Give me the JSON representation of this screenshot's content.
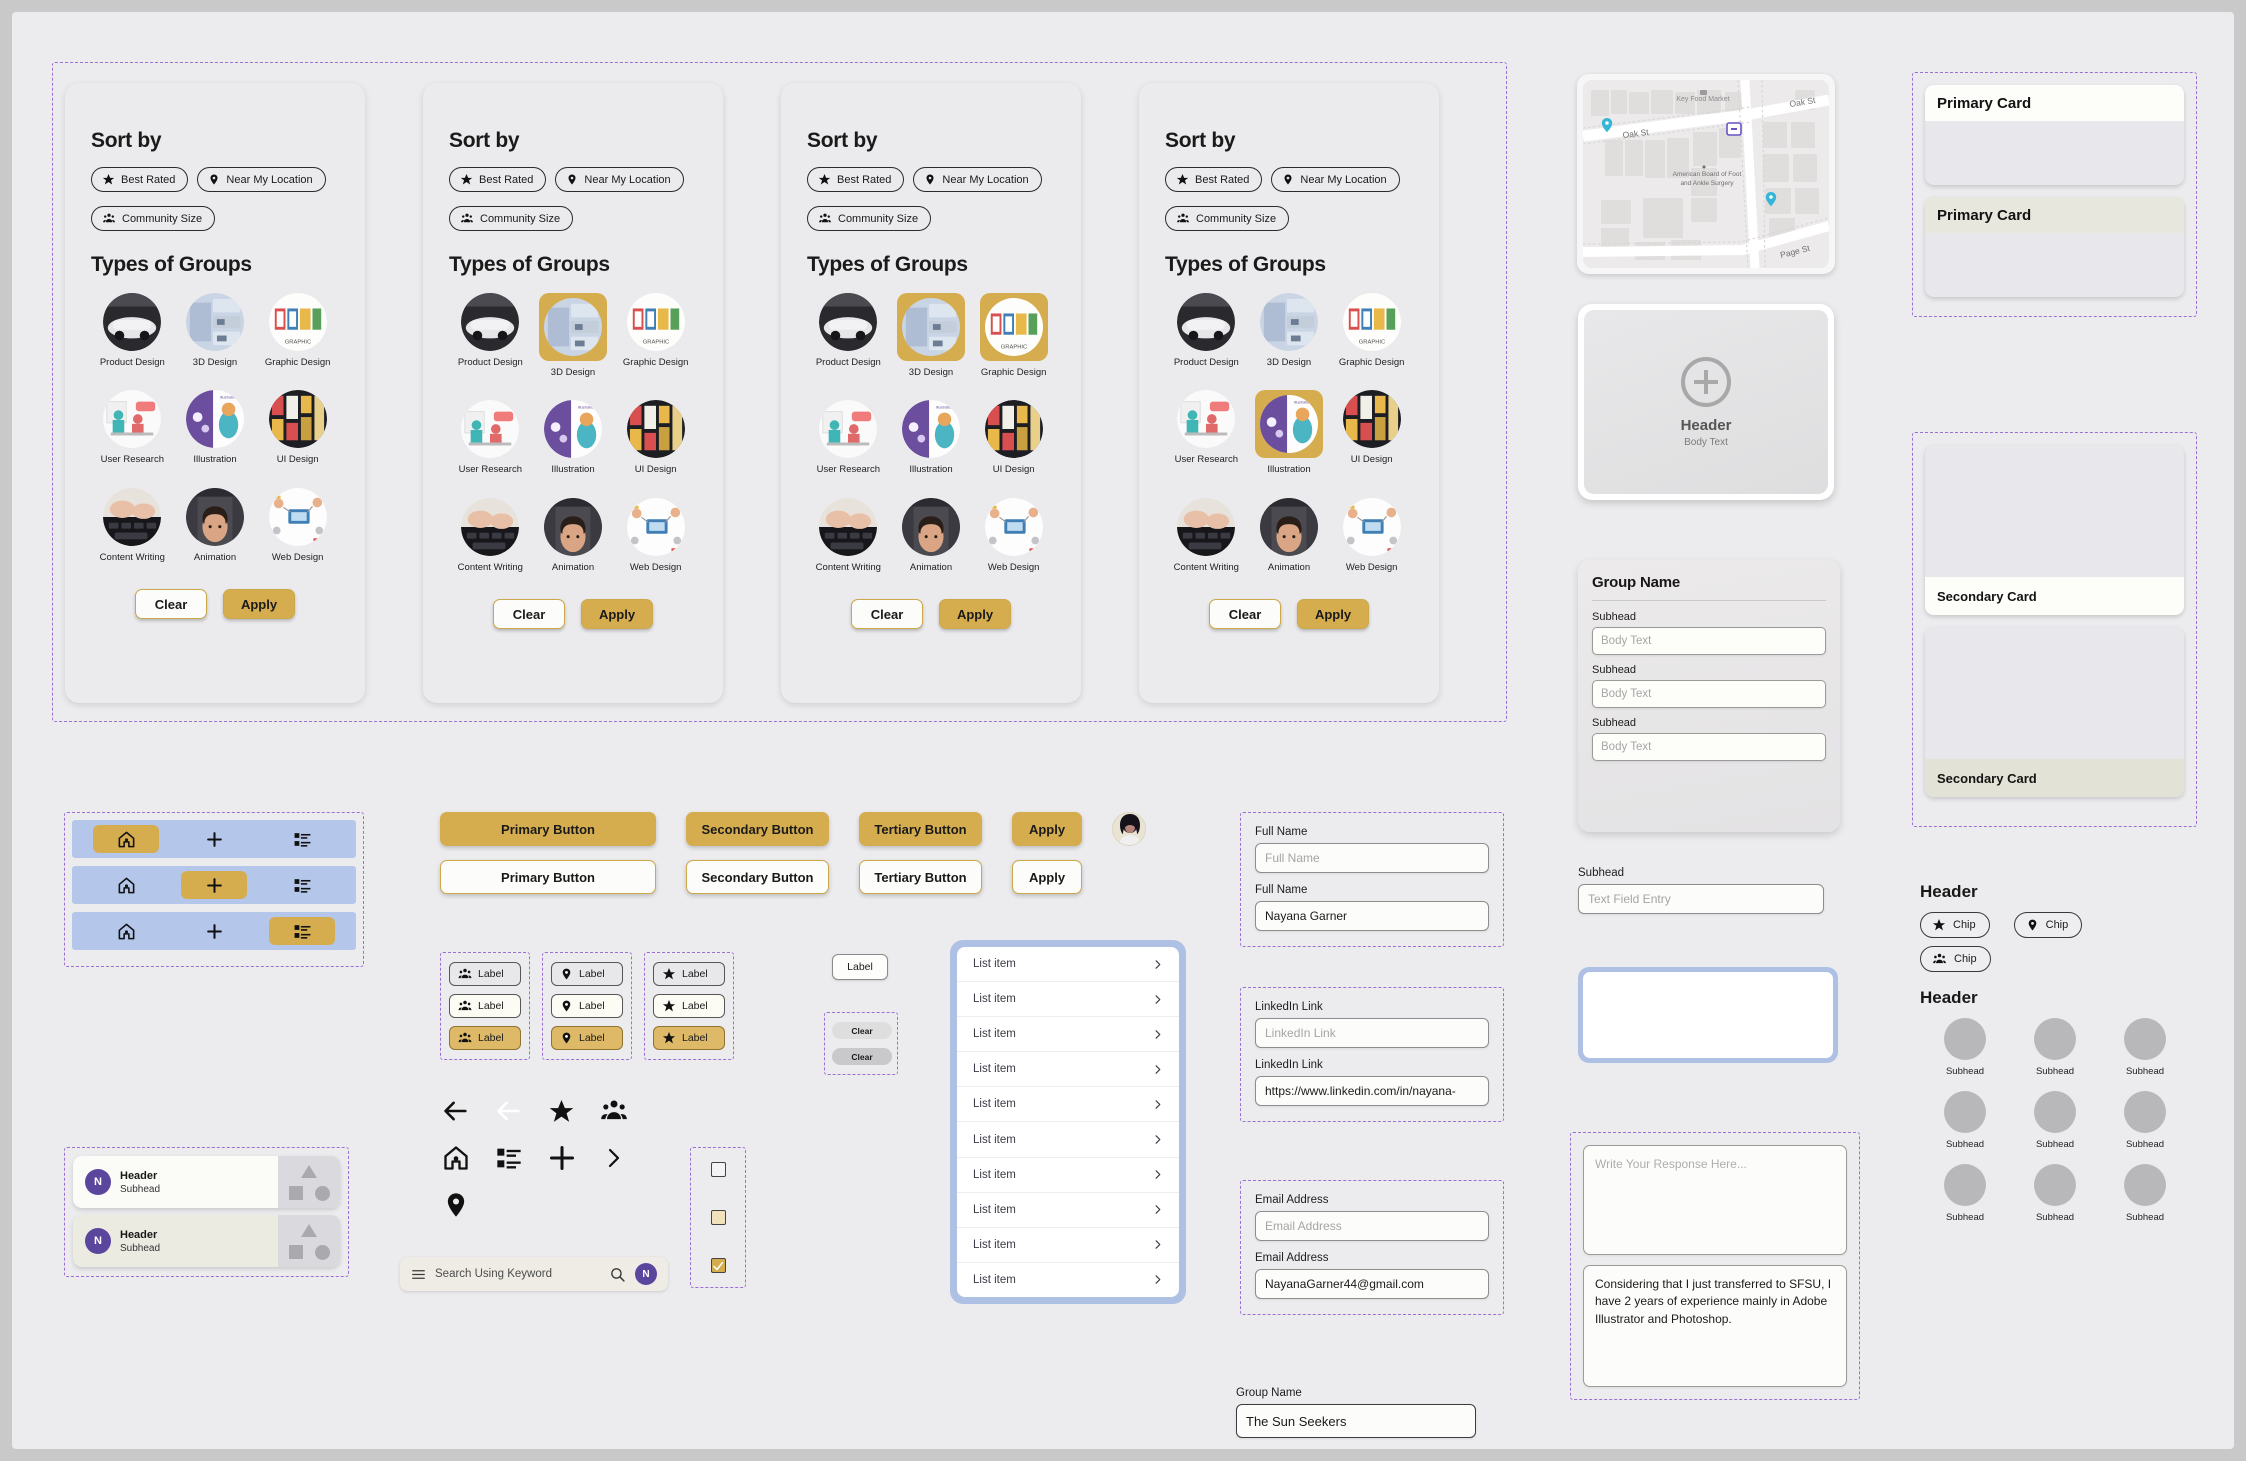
{
  "filters": {
    "sort_title": "Sort by",
    "types_title": "Types of Groups",
    "sort_chips": [
      "Best Rated",
      "Near My Location",
      "Community Size"
    ],
    "group_types": [
      "Product Design",
      "3D Design",
      "Graphic Design",
      "User Research",
      "Illustration",
      "UI Design",
      "Content Writing",
      "Animation",
      "Web Design"
    ],
    "clear_label": "Clear",
    "apply_label": "Apply",
    "panels": [
      {
        "selected": []
      },
      {
        "selected": [
          1
        ]
      },
      {
        "selected": [
          1,
          2
        ]
      },
      {
        "selected": [
          4
        ]
      }
    ]
  },
  "buttons": {
    "primary": "Primary Button",
    "secondary": "Secondary Button",
    "tertiary": "Tertiary Button",
    "apply": "Apply"
  },
  "labels": {
    "label": "Label",
    "clear": "Clear"
  },
  "search": {
    "placeholder": "Search Using Keyword",
    "avatar_initial": "N"
  },
  "list_panel": {
    "item_label": "List item",
    "count": 10
  },
  "list_cards": {
    "header": "Header",
    "subhead": "Subhead",
    "initial": "N"
  },
  "forms": {
    "full_name_label": "Full Name",
    "full_name_placeholder": "Full Name",
    "full_name_value": "Nayana Garner",
    "linkedin_label": "LinkedIn Link",
    "linkedin_placeholder": "LinkedIn Link",
    "linkedin_value": "https://www.linkedin.com/in/nayana-",
    "email_label": "Email Address",
    "email_placeholder": "Email Address",
    "email_value": "NayanaGarner44@gmail.com",
    "group_name_label": "Group Name",
    "group_name_value": "The Sun Seekers"
  },
  "map": {
    "streets": [
      "Oak St",
      "Oak St",
      "Page St"
    ],
    "poi_market": "Key Food Market",
    "poi_board": "American Board of Foot and Ankle Surgery"
  },
  "upload_card": {
    "header": "Header",
    "body": "Body Text"
  },
  "group_card": {
    "title": "Group Name",
    "subhead": "Subhead",
    "body_placeholder": "Body Text",
    "rows": 3
  },
  "text_field_entry": {
    "subhead": "Subhead",
    "placeholder": "Text Field Entry"
  },
  "response": {
    "placeholder": "Write Your Response Here...",
    "value": "Considering that I just transferred to SFSU, I have 2 years of experience mainly in Adobe Illustrator and Photoshop."
  },
  "cards": {
    "primary": "Primary Card",
    "secondary": "Secondary Card"
  },
  "header_section": {
    "header_chips": "Header",
    "header_avatars": "Header",
    "chips": [
      "Chip",
      "Chip",
      "Chip"
    ],
    "avatar_labels": [
      "Subhead",
      "Subhead",
      "Subhead",
      "Subhead",
      "Subhead",
      "Subhead",
      "Subhead",
      "Subhead",
      "Subhead"
    ]
  },
  "colors": {
    "accent_gold": "#d6ad4e",
    "accent_gold_border": "#cda84a",
    "board_bg": "#ececee",
    "nav_blue": "#b4c7ea",
    "avatar_purple": "#5b469e",
    "annotation_purple": "#9b6fd4"
  }
}
